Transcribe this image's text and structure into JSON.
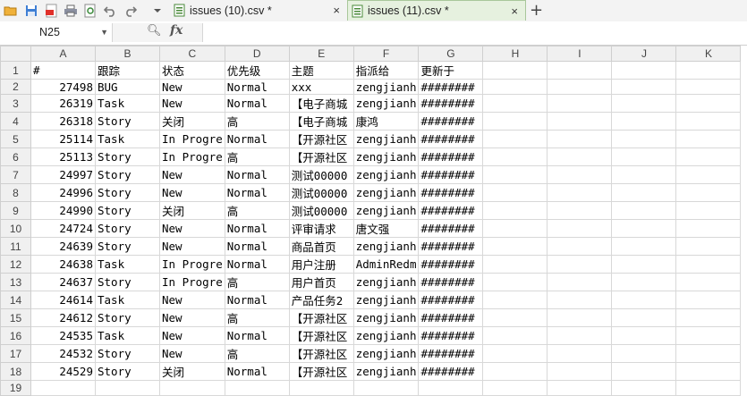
{
  "toolbar": {
    "icons": [
      "folder-open-icon",
      "save-icon",
      "pdf-export-icon",
      "print-icon",
      "print-preview-icon",
      "undo-icon",
      "redo-icon",
      "dropdown-icon"
    ]
  },
  "tabs": [
    {
      "label": "issues (10).csv *",
      "close": "×"
    },
    {
      "label": "issues (11).csv *",
      "close": "×"
    }
  ],
  "new_tab": "+",
  "formula_bar": {
    "cell_ref": "N25",
    "fx": "fx",
    "formula": ""
  },
  "columns": [
    "A",
    "B",
    "C",
    "D",
    "E",
    "F",
    "G",
    "H",
    "I",
    "J",
    "K"
  ],
  "rows": [
    [
      "#",
      "跟踪",
      "状态",
      "优先级",
      "主题",
      "指派给",
      "更新于",
      "",
      "",
      "",
      ""
    ],
    [
      "27498",
      "BUG",
      "New",
      "Normal",
      "xxx",
      "zengjianh",
      "########",
      "",
      "",
      "",
      ""
    ],
    [
      "26319",
      "Task",
      "New",
      "Normal",
      "【电子商城",
      "zengjianh",
      "########",
      "",
      "",
      "",
      ""
    ],
    [
      "26318",
      "Story",
      "关闭",
      "高",
      "【电子商城",
      "康鸿",
      "########",
      "",
      "",
      "",
      ""
    ],
    [
      "25114",
      "Task",
      "In Progre",
      "Normal",
      "【开源社区",
      "zengjianh",
      "########",
      "",
      "",
      "",
      ""
    ],
    [
      "25113",
      "Story",
      "In Progre",
      "高",
      "【开源社区",
      "zengjianh",
      "########",
      "",
      "",
      "",
      ""
    ],
    [
      "24997",
      "Story",
      "New",
      "Normal",
      "测试00000",
      "zengjianh",
      "########",
      "",
      "",
      "",
      ""
    ],
    [
      "24996",
      "Story",
      "New",
      "Normal",
      "测试00000",
      "zengjianh",
      "########",
      "",
      "",
      "",
      ""
    ],
    [
      "24990",
      "Story",
      "关闭",
      "高",
      "测试00000",
      "zengjianh",
      "########",
      "",
      "",
      "",
      ""
    ],
    [
      "24724",
      "Story",
      "New",
      "Normal",
      "评审请求",
      "唐文强",
      "########",
      "",
      "",
      "",
      ""
    ],
    [
      "24639",
      "Story",
      "New",
      "Normal",
      "商品首页",
      "zengjianh",
      "########",
      "",
      "",
      "",
      ""
    ],
    [
      "24638",
      "Task",
      "In Progre",
      "Normal",
      "用户注册",
      "AdminRedm",
      "########",
      "",
      "",
      "",
      ""
    ],
    [
      "24637",
      "Story",
      "In Progre",
      "高",
      "用户首页",
      "zengjianh",
      "########",
      "",
      "",
      "",
      ""
    ],
    [
      "24614",
      "Task",
      "New",
      "Normal",
      "产品任务2",
      "zengjianh",
      "########",
      "",
      "",
      "",
      ""
    ],
    [
      "24612",
      "Story",
      "New",
      "高",
      "【开源社区",
      "zengjianh",
      "########",
      "",
      "",
      "",
      ""
    ],
    [
      "24535",
      "Task",
      "New",
      "Normal",
      "【开源社区",
      "zengjianh",
      "########",
      "",
      "",
      "",
      ""
    ],
    [
      "24532",
      "Story",
      "New",
      "高",
      "【开源社区",
      "zengjianh",
      "########",
      "",
      "",
      "",
      ""
    ],
    [
      "24529",
      "Story",
      "关闭",
      "Normal",
      "【开源社区",
      "zengjianh",
      "########",
      "",
      "",
      "",
      ""
    ],
    [
      "",
      "",
      "",
      "",
      "",
      "",
      "",
      "",
      "",
      "",
      ""
    ]
  ],
  "row_numbers": [
    "1",
    "2",
    "3",
    "4",
    "5",
    "6",
    "7",
    "8",
    "9",
    "10",
    "11",
    "12",
    "13",
    "14",
    "15",
    "16",
    "17",
    "18",
    "19"
  ],
  "colors": {
    "accent_tab": "#e6f1df",
    "header_bg": "#f0f0f0"
  }
}
